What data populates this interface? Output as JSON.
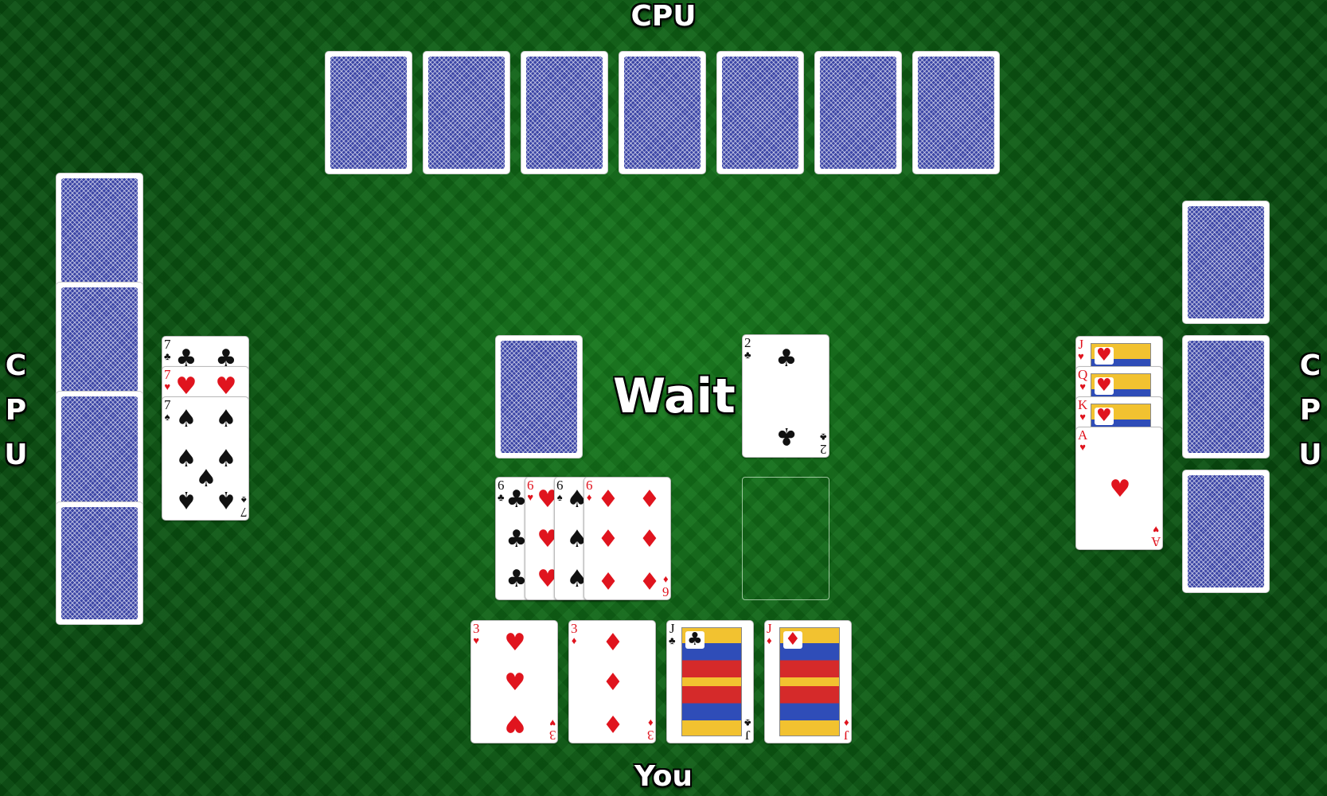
{
  "labels": {
    "top_opponent": "CPU",
    "left_opponent": [
      "C",
      "P",
      "U"
    ],
    "right_opponent": [
      "C",
      "P",
      "U"
    ],
    "player": "You"
  },
  "status": "Wait",
  "top_opponent": {
    "hand_count": 7
  },
  "left_opponent": {
    "hand_count": 4,
    "played": [
      {
        "rank": "7",
        "suit": "♣",
        "color": "black"
      },
      {
        "rank": "7",
        "suit": "♥",
        "color": "red"
      },
      {
        "rank": "7",
        "suit": "♠",
        "color": "black"
      }
    ]
  },
  "right_opponent": {
    "hand_count": 3,
    "played": [
      {
        "rank": "J",
        "suit": "♥",
        "color": "red"
      },
      {
        "rank": "Q",
        "suit": "♥",
        "color": "red"
      },
      {
        "rank": "K",
        "suit": "♥",
        "color": "red"
      },
      {
        "rank": "A",
        "suit": "♥",
        "color": "red"
      }
    ]
  },
  "center": {
    "draw_pile": "face-down",
    "discard_top": {
      "rank": "2",
      "suit": "♣",
      "color": "black"
    },
    "player_played": [
      {
        "rank": "6",
        "suit": "♣",
        "color": "black"
      },
      {
        "rank": "6",
        "suit": "♥",
        "color": "red"
      },
      {
        "rank": "6",
        "suit": "♠",
        "color": "black"
      },
      {
        "rank": "6",
        "suit": "♦",
        "color": "red"
      }
    ]
  },
  "player_hand": [
    {
      "rank": "3",
      "suit": "♥",
      "color": "red"
    },
    {
      "rank": "3",
      "suit": "♦",
      "color": "red"
    },
    {
      "rank": "J",
      "suit": "♣",
      "color": "black"
    },
    {
      "rank": "J",
      "suit": "♦",
      "color": "red"
    }
  ],
  "colors": {
    "felt": "#0b6a15",
    "card_back": "#3b45a6",
    "red_suit": "#e0141e"
  }
}
